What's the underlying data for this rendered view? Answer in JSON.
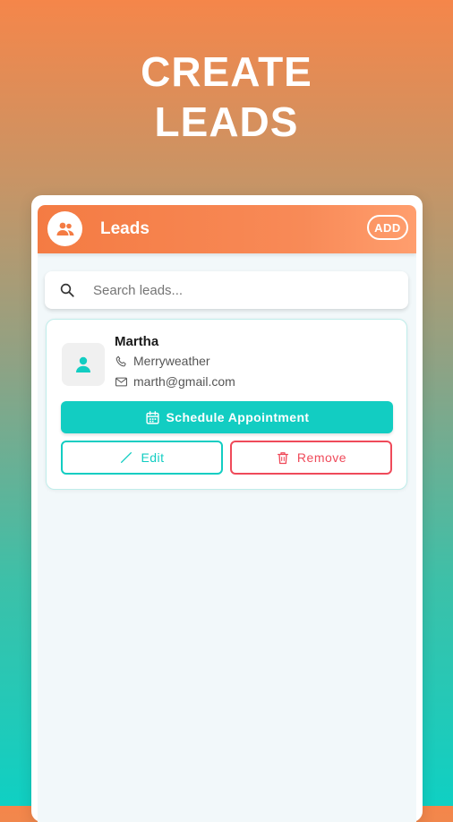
{
  "promo": {
    "headline_line1": "CREATE",
    "headline_line2": "LEADS"
  },
  "appbar": {
    "title": "Leads",
    "add_label": "ADD",
    "avatar_icon": "group-icon"
  },
  "search": {
    "placeholder": "Search leads...",
    "value": ""
  },
  "leads": [
    {
      "name": "Martha",
      "phone": "Merryweather",
      "email": "marth@gmail.com",
      "schedule_label": "Schedule Appointment",
      "edit_label": "Edit",
      "remove_label": "Remove"
    }
  ],
  "colors": {
    "accent_orange": "#F47B43",
    "accent_teal": "#12CDC2",
    "danger_red": "#EF4A5A"
  }
}
